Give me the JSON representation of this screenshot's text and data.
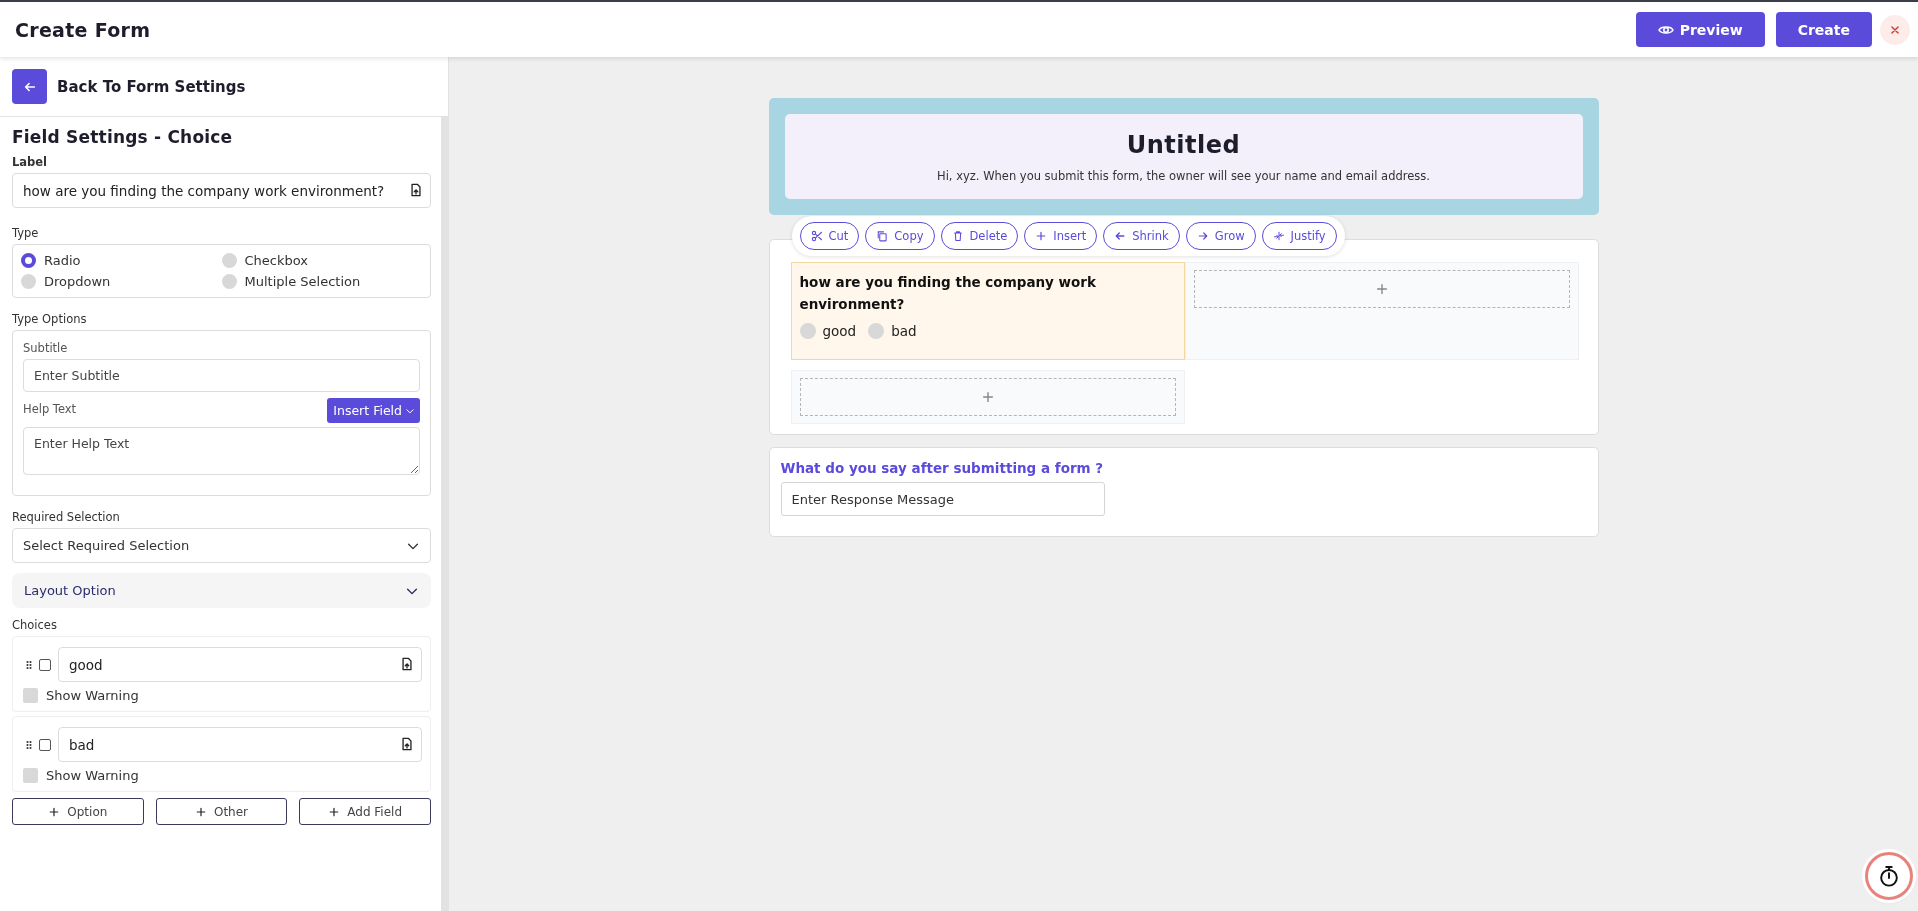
{
  "header": {
    "title": "Create Form",
    "preview_button": "Preview",
    "create_button": "Create"
  },
  "sidebar": {
    "back_button_label": "Back To Form Settings",
    "heading": "Field Settings - Choice",
    "label_title": "Label",
    "label_value": "how are you finding the company work environment?",
    "type_title": "Type",
    "types": [
      {
        "label": "Radio",
        "selected": true
      },
      {
        "label": "Checkbox",
        "selected": false
      },
      {
        "label": "Dropdown",
        "selected": false
      },
      {
        "label": "Multiple Selection",
        "selected": false
      }
    ],
    "type_options_title": "Type Options",
    "subtitle_label": "Subtitle",
    "subtitle_placeholder": "Enter Subtitle",
    "help_text_label": "Help Text",
    "insert_field_button": "Insert Field",
    "help_text_placeholder": "Enter Help Text",
    "required_selection": {
      "label": "Required Selection",
      "placeholder": "Select Required Selection"
    },
    "layout_option": {
      "label": "Layout Option",
      "expanded": false
    },
    "choices_title": "Choices",
    "choices": [
      {
        "value": "good",
        "checked": false,
        "warning_label": "Show Warning",
        "show_warning": false
      },
      {
        "value": "bad",
        "checked": false,
        "warning_label": "Show Warning",
        "show_warning": false
      }
    ],
    "buttons": [
      "Option",
      "Other",
      "Add Field"
    ]
  },
  "form": {
    "title": "Untitled",
    "description": "Hi, xyz. When you submit this form, the owner will see your name and email address.",
    "toolbar": [
      "Cut",
      "Copy",
      "Delete",
      "Insert",
      "Shrink",
      "Grow",
      "Justify"
    ],
    "question": {
      "label": "how are you finding the company work environment?",
      "options": [
        {
          "label": "good",
          "selected": false
        },
        {
          "label": "bad",
          "selected": false
        }
      ]
    },
    "response": {
      "label": "What do you say after submitting a form ?",
      "placeholder": "Enter Response Message"
    }
  }
}
